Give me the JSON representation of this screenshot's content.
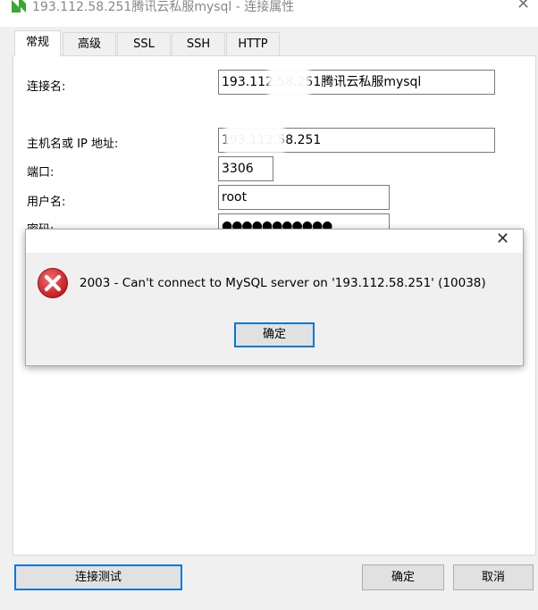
{
  "window": {
    "title": "193.112.58.251腾讯云私服mysql - 连接属性"
  },
  "tabs": [
    {
      "label": "常规",
      "active": true
    },
    {
      "label": "高级"
    },
    {
      "label": "SSL"
    },
    {
      "label": "SSH"
    },
    {
      "label": "HTTP"
    }
  ],
  "form": {
    "connection_name_label": "连接名:",
    "connection_name_value": "193.112.58.251腾讯云私服mysql",
    "host_label": "主机名或 IP 地址:",
    "host_value": "193.112.58.251",
    "port_label": "端口:",
    "port_value": "3306",
    "user_label": "用户名:",
    "user_value": "root",
    "password_label": "密码:",
    "password_mask": "●●●●●●●●●●●"
  },
  "error_dialog": {
    "message": "2003 - Can't connect to MySQL server on '193.112.58.251' (10038)",
    "ok_label": "确定",
    "close_glyph": "✕",
    "icon": "error-icon"
  },
  "footer": {
    "test_label": "连接测试",
    "ok_label": "确定",
    "cancel_label": "取消"
  },
  "colors": {
    "accent": "#0078d7",
    "error_red": "#d9262b"
  }
}
